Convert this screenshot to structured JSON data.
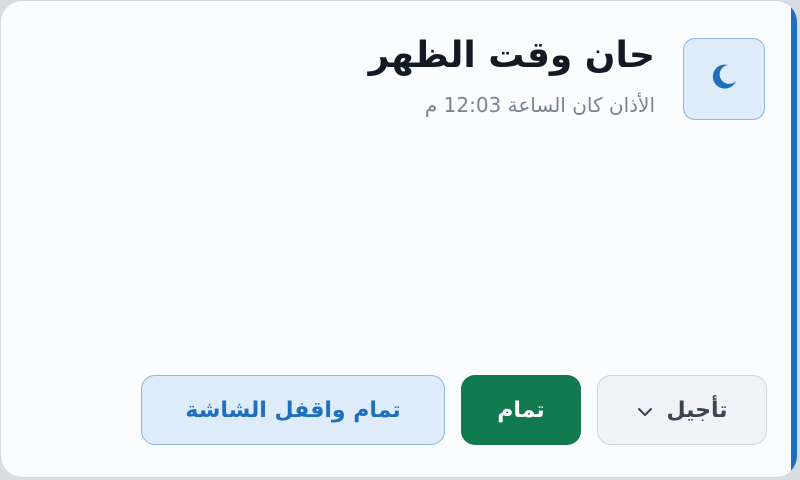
{
  "alert": {
    "title": "حان وقت الظهر",
    "subtitle": "الأذان كان الساعة 12:03 م",
    "icon": "moon-icon"
  },
  "actions": {
    "snooze_label": "تأجيل",
    "snooze_icon": "chevron-down-icon",
    "done_label": "تمام",
    "done_lock_label": "تمام واقفل الشاشة"
  },
  "colors": {
    "accent": "#1f6fbf",
    "done": "#127a4f",
    "title": "#141a24",
    "subtitle": "#7a8390"
  }
}
